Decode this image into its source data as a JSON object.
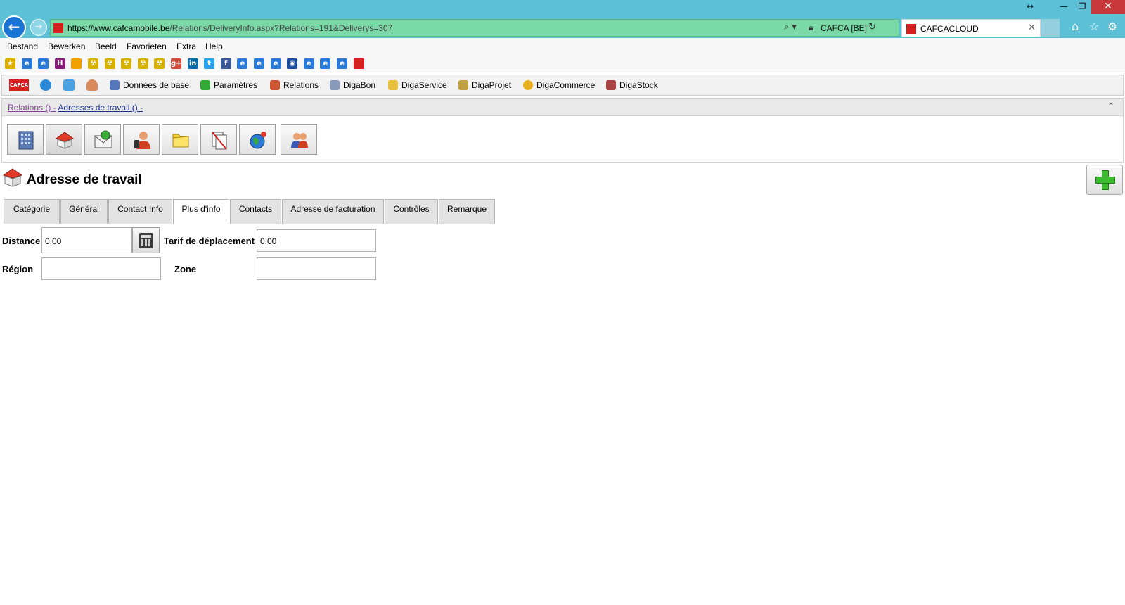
{
  "browser": {
    "window_controls": {
      "resize": "↔",
      "minimize": "—",
      "maximize": "❐",
      "close": "✕"
    },
    "url_host": "https://www.cafcamobile.be",
    "url_path": "/Relations/DeliveryInfo.aspx?Relations=191&Deliverys=307",
    "cert_label": "CAFCA [BE]",
    "tab_title": "CAFCACLOUD",
    "icons": [
      "back-icon",
      "forward-icon",
      "search-icon",
      "lock-icon",
      "refresh-icon",
      "home-icon",
      "star-icon",
      "gear-icon"
    ]
  },
  "menu": [
    "Bestand",
    "Bewerken",
    "Beeld",
    "Favorieten",
    "Extra",
    "Help"
  ],
  "favorites": [
    {
      "name": "favorites-star-icon",
      "glyph": "★",
      "color": "#e0b000"
    },
    {
      "name": "ie-page-icon",
      "glyph": "e",
      "color": "#2a7bd8"
    },
    {
      "name": "ie-page-icon",
      "glyph": "e",
      "color": "#2a7bd8"
    },
    {
      "name": "h-logo-icon",
      "glyph": "H",
      "color": "#8a1a7a"
    },
    {
      "name": "flag-be-icon",
      "glyph": "",
      "color": "#f0a000"
    },
    {
      "name": "radiation-icon",
      "glyph": "☢",
      "color": "#d8b000"
    },
    {
      "name": "radiation-icon",
      "glyph": "☢",
      "color": "#d8b000"
    },
    {
      "name": "radiation-icon",
      "glyph": "☢",
      "color": "#d8b000"
    },
    {
      "name": "radiation-icon",
      "glyph": "☢",
      "color": "#d8b000"
    },
    {
      "name": "radiation-icon",
      "glyph": "☢",
      "color": "#d8b000"
    },
    {
      "name": "google-plus-icon",
      "glyph": "g+",
      "color": "#d44a3a"
    },
    {
      "name": "linkedin-icon",
      "glyph": "in",
      "color": "#0e6aa8"
    },
    {
      "name": "twitter-icon",
      "glyph": "t",
      "color": "#2aa3ef"
    },
    {
      "name": "facebook-icon",
      "glyph": "f",
      "color": "#3b5998"
    },
    {
      "name": "ie-page-icon",
      "glyph": "e",
      "color": "#2a7bd8"
    },
    {
      "name": "ie-page-icon",
      "glyph": "e",
      "color": "#2a7bd8"
    },
    {
      "name": "ie-page-icon",
      "glyph": "e",
      "color": "#2a7bd8"
    },
    {
      "name": "globe-icon",
      "glyph": "◉",
      "color": "#1a4fa0"
    },
    {
      "name": "ie-page-icon",
      "glyph": "e",
      "color": "#2a7bd8"
    },
    {
      "name": "ie-page-icon",
      "glyph": "e",
      "color": "#2a7bd8"
    },
    {
      "name": "ie-page-icon",
      "glyph": "e",
      "color": "#2a7bd8"
    },
    {
      "name": "cafca-icon",
      "glyph": "",
      "color": "#d62020"
    }
  ],
  "app_nav": {
    "logo_text": "CAFCA",
    "items": [
      {
        "label": "Données de base",
        "icon": "database-icon",
        "color": "#5577bb"
      },
      {
        "label": "Paramètres",
        "icon": "settings-icon",
        "color": "#33aa33"
      },
      {
        "label": "Relations",
        "icon": "relations-icon",
        "color": "#cc5533"
      },
      {
        "label": "DigaBon",
        "icon": "digabon-icon",
        "color": "#8899bb"
      },
      {
        "label": "DigaService",
        "icon": "digaservice-icon",
        "color": "#e8c040"
      },
      {
        "label": "DigaProjet",
        "icon": "digaprojet-icon",
        "color": "#c0a040"
      },
      {
        "label": "DigaCommerce",
        "icon": "digacommerce-icon",
        "color": "#e8b020"
      },
      {
        "label": "DigaStock",
        "icon": "digastock-icon",
        "color": "#aa4444"
      }
    ]
  },
  "breadcrumb": {
    "part1": "Relations () -",
    "part2": "Adresses de travail () -"
  },
  "toolbar_icons": [
    "building-icon",
    "house-icon",
    "mail-icon",
    "contact-person-icon",
    "folder-icon",
    "document-icon",
    "globe-icon",
    "users-icon"
  ],
  "page": {
    "title": "Adresse de travail"
  },
  "tabs": [
    "Catégorie",
    "Général",
    "Contact Info",
    "Plus d'info",
    "Contacts",
    "Adresse de facturation",
    "Contrôles",
    "Remarque"
  ],
  "active_tab": "Plus d'info",
  "form": {
    "distance_label": "Distance",
    "distance_value": "0,00",
    "tarif_label": "Tarif de déplacement",
    "tarif_value": "0,00",
    "region_label": "Région",
    "region_value": "",
    "zone_label": "Zone",
    "zone_value": ""
  }
}
